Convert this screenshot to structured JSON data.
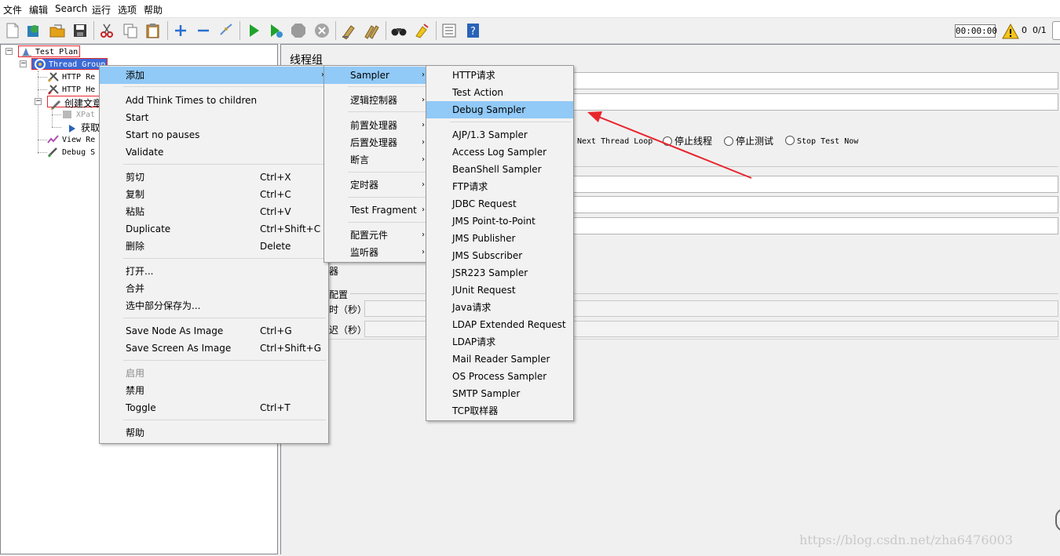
{
  "menubar": [
    "文件",
    "编辑",
    "Search",
    "运行",
    "选项",
    "帮助"
  ],
  "toolbar": {
    "icons": [
      "new-icon",
      "templates-icon",
      "open-icon",
      "save-icon",
      "cut-icon",
      "copy-icon",
      "paste-icon",
      "expand-icon",
      "collapse-icon",
      "toggle-icon",
      "start-icon",
      "start-no-pause-icon",
      "stop-icon",
      "shutdown-icon",
      "clear-icon",
      "clear-all-icon",
      "search-icon",
      "reset-search-icon",
      "function-helper-icon",
      "help-icon"
    ],
    "timer": "00:00:00",
    "warning_count": "0",
    "threads": "0/1"
  },
  "tree": {
    "nodes": [
      "Test Plan",
      "Thread Group",
      "HTTP Re",
      "HTTP He",
      "创建文章",
      "XPat",
      "获取",
      "View Re",
      "Debug S"
    ]
  },
  "panel": {
    "title": "线程组",
    "radios": [
      "Next Thread Loop",
      "停止线程",
      "停止测试",
      "Stop Test Now"
    ],
    "label_scheduler": "器",
    "label_config": "配置",
    "label_duration": "时（秒）",
    "label_delay": "迟（秒）"
  },
  "context_menu": {
    "items": [
      {
        "label": "添加",
        "submenu": true
      },
      {
        "label": "Add Think Times to children"
      },
      {
        "label": "Start"
      },
      {
        "label": "Start no pauses"
      },
      {
        "label": "Validate"
      },
      {
        "label": "剪切",
        "shortcut": "Ctrl+X"
      },
      {
        "label": "复制",
        "shortcut": "Ctrl+C"
      },
      {
        "label": "粘贴",
        "shortcut": "Ctrl+V"
      },
      {
        "label": "Duplicate",
        "shortcut": "Ctrl+Shift+C"
      },
      {
        "label": "删除",
        "shortcut": "Delete"
      },
      {
        "label": "打开..."
      },
      {
        "label": "合并"
      },
      {
        "label": "选中部分保存为..."
      },
      {
        "label": "Save Node As Image",
        "shortcut": "Ctrl+G"
      },
      {
        "label": "Save Screen As Image",
        "shortcut": "Ctrl+Shift+G"
      },
      {
        "label": "启用",
        "disabled": true
      },
      {
        "label": "禁用"
      },
      {
        "label": "Toggle",
        "shortcut": "Ctrl+T"
      },
      {
        "label": "帮助"
      }
    ]
  },
  "add_menu": {
    "items": [
      "Sampler",
      "逻辑控制器",
      "前置处理器",
      "后置处理器",
      "断言",
      "定时器",
      "Test Fragment",
      "配置元件",
      "监听器"
    ]
  },
  "sampler_menu": {
    "items": [
      "HTTP请求",
      "Test Action",
      "Debug Sampler",
      "AJP/1.3 Sampler",
      "Access Log Sampler",
      "BeanShell Sampler",
      "FTP请求",
      "JDBC Request",
      "JMS Point-to-Point",
      "JMS Publisher",
      "JMS Subscriber",
      "JSR223 Sampler",
      "JUnit Request",
      "Java请求",
      "LDAP Extended Request",
      "LDAP请求",
      "Mail Reader Sampler",
      "OS Process Sampler",
      "SMTP Sampler",
      "TCP取样器"
    ],
    "selected": "Debug Sampler"
  },
  "annotation": {
    "arrow_color": "#e8252d",
    "box_color": "#e8252d"
  },
  "watermark": "https://blog.csdn.net/zha6476003"
}
